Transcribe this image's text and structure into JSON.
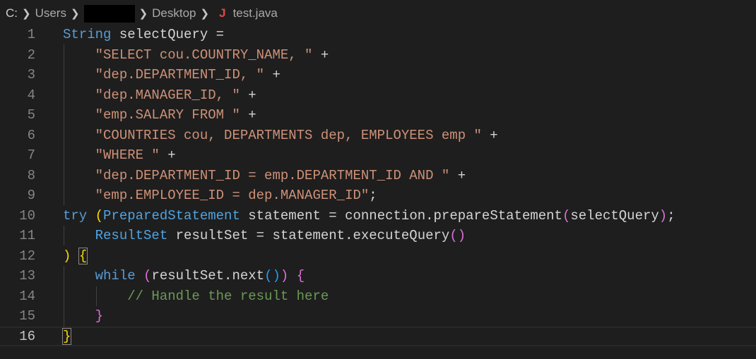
{
  "breadcrumb": {
    "items": [
      "C:",
      "Users",
      "Desktop",
      "test.java"
    ],
    "file_icon": "J"
  },
  "editor": {
    "current_line": 16,
    "lines": [
      {
        "n": "1",
        "tokens": [
          {
            "t": "String",
            "c": "kw"
          },
          {
            "t": " selectQuery =",
            "c": "pl"
          }
        ]
      },
      {
        "n": "2",
        "tokens": [
          {
            "t": "    ",
            "c": "pl"
          },
          {
            "t": "\"SELECT cou.COUNTRY_NAME, \"",
            "c": "str"
          },
          {
            "t": " +",
            "c": "pl"
          }
        ]
      },
      {
        "n": "3",
        "tokens": [
          {
            "t": "    ",
            "c": "pl"
          },
          {
            "t": "\"dep.DEPARTMENT_ID, \"",
            "c": "str"
          },
          {
            "t": " +",
            "c": "pl"
          }
        ]
      },
      {
        "n": "4",
        "tokens": [
          {
            "t": "    ",
            "c": "pl"
          },
          {
            "t": "\"dep.MANAGER_ID, \"",
            "c": "str"
          },
          {
            "t": " +",
            "c": "pl"
          }
        ]
      },
      {
        "n": "5",
        "tokens": [
          {
            "t": "    ",
            "c": "pl"
          },
          {
            "t": "\"emp.SALARY FROM \"",
            "c": "str"
          },
          {
            "t": " +",
            "c": "pl"
          }
        ]
      },
      {
        "n": "6",
        "tokens": [
          {
            "t": "    ",
            "c": "pl"
          },
          {
            "t": "\"COUNTRIES cou, DEPARTMENTS dep, EMPLOYEES emp \"",
            "c": "str"
          },
          {
            "t": " +",
            "c": "pl"
          }
        ]
      },
      {
        "n": "7",
        "tokens": [
          {
            "t": "    ",
            "c": "pl"
          },
          {
            "t": "\"WHERE \"",
            "c": "str"
          },
          {
            "t": " +",
            "c": "pl"
          }
        ]
      },
      {
        "n": "8",
        "tokens": [
          {
            "t": "    ",
            "c": "pl"
          },
          {
            "t": "\"dep.DEPARTMENT_ID = emp.DEPARTMENT_ID AND \"",
            "c": "str"
          },
          {
            "t": " +",
            "c": "pl"
          }
        ]
      },
      {
        "n": "9",
        "tokens": [
          {
            "t": "    ",
            "c": "pl"
          },
          {
            "t": "\"emp.EMPLOYEE_ID = dep.MANAGER_ID\"",
            "c": "str"
          },
          {
            "t": ";",
            "c": "pl"
          }
        ]
      },
      {
        "n": "10",
        "tokens": [
          {
            "t": "try",
            "c": "kw"
          },
          {
            "t": " ",
            "c": "pl"
          },
          {
            "t": "(",
            "c": "b1"
          },
          {
            "t": "PreparedStatement",
            "c": "ty"
          },
          {
            "t": " statement = connection.prepareStatement",
            "c": "pl"
          },
          {
            "t": "(",
            "c": "b2"
          },
          {
            "t": "selectQuery",
            "c": "pl"
          },
          {
            "t": ")",
            "c": "b2"
          },
          {
            "t": ";",
            "c": "pl"
          }
        ]
      },
      {
        "n": "11",
        "tokens": [
          {
            "t": "    ",
            "c": "pl"
          },
          {
            "t": "ResultSet",
            "c": "ty"
          },
          {
            "t": " resultSet = statement.executeQuery",
            "c": "pl"
          },
          {
            "t": "()",
            "c": "b2"
          }
        ]
      },
      {
        "n": "12",
        "tokens": [
          {
            "t": ")",
            "c": "b1"
          },
          {
            "t": " ",
            "c": "pl"
          },
          {
            "t": "{",
            "c": "b1 match"
          }
        ]
      },
      {
        "n": "13",
        "tokens": [
          {
            "t": "    ",
            "c": "pl"
          },
          {
            "t": "while",
            "c": "kw"
          },
          {
            "t": " ",
            "c": "pl"
          },
          {
            "t": "(",
            "c": "b2"
          },
          {
            "t": "resultSet.next",
            "c": "pl"
          },
          {
            "t": "()",
            "c": "b3"
          },
          {
            "t": ")",
            "c": "b2"
          },
          {
            "t": " ",
            "c": "pl"
          },
          {
            "t": "{",
            "c": "b2"
          }
        ]
      },
      {
        "n": "14",
        "tokens": [
          {
            "t": "        ",
            "c": "pl"
          },
          {
            "t": "// Handle the result here",
            "c": "cm"
          }
        ]
      },
      {
        "n": "15",
        "tokens": [
          {
            "t": "    ",
            "c": "pl"
          },
          {
            "t": "}",
            "c": "b2"
          }
        ]
      },
      {
        "n": "16",
        "tokens": [
          {
            "t": "}",
            "c": "b1 match"
          }
        ]
      }
    ]
  },
  "colors": {
    "background": "#1e1e1e",
    "keyword": "#569cd6",
    "string": "#ce9178",
    "comment": "#6a9955"
  }
}
